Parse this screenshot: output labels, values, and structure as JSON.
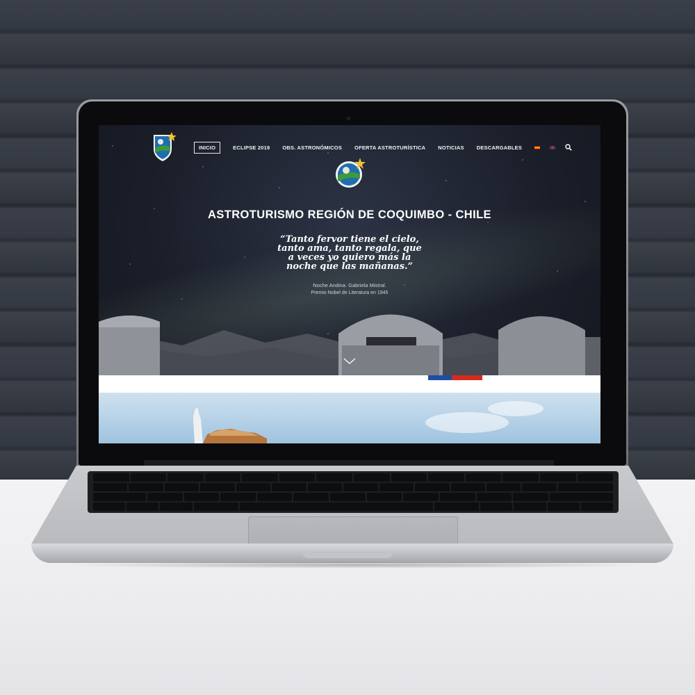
{
  "nav": {
    "items": [
      {
        "label": "INICIO",
        "active": true
      },
      {
        "label": "ECLIPSE 2019",
        "active": false
      },
      {
        "label": "OBS. ASTRONÓMICOS",
        "active": false
      },
      {
        "label": "OFERTA ASTROTURÍSTICA",
        "active": false
      },
      {
        "label": "NOTICIAS",
        "active": false
      },
      {
        "label": "DESCARGABLES",
        "active": false
      }
    ],
    "languages": [
      "es-flag-icon",
      "uk-flag-icon"
    ],
    "search_icon": "search-icon"
  },
  "hero": {
    "title": "ASTROTURISMO REGIÓN DE COQUIMBO - CHILE",
    "quote_lines": [
      "“Tanto fervor tiene el cielo,",
      "tanto ama, tanto regala, que",
      "a veces yo quiero más la",
      "noche que las mañanas.”"
    ],
    "author": "Noche Andina. Gabriela Mistral.",
    "prize": "Premio Nobel de Literatura en 1945"
  },
  "colors": {
    "night_sky": "#1b1f2a",
    "chile_blue": "#1d4ea1",
    "chile_red": "#d52b1e",
    "nav_text": "#f3f3f3"
  }
}
